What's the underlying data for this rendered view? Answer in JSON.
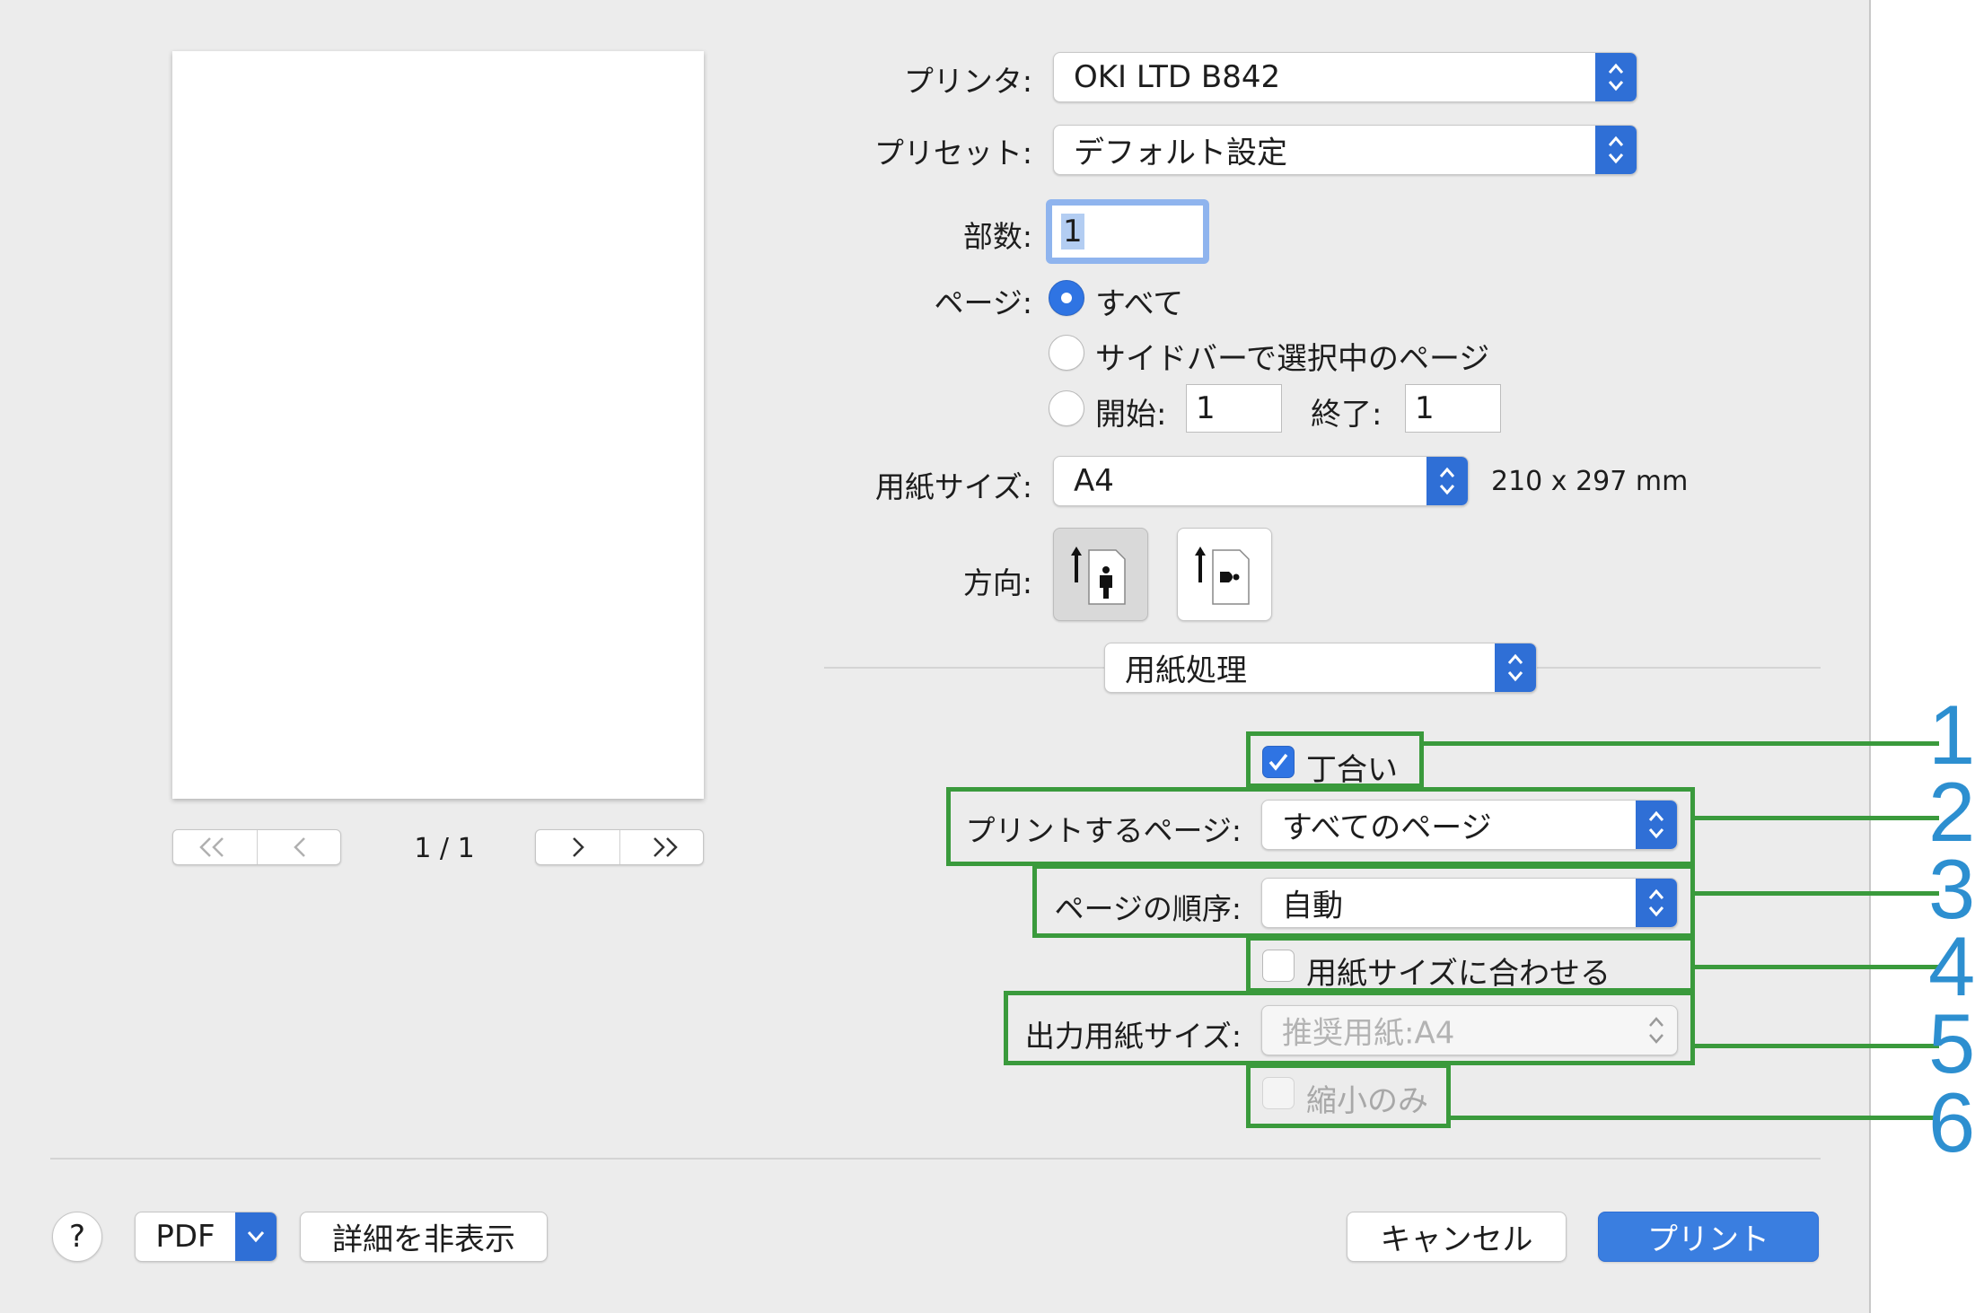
{
  "printer": {
    "label": "プリンタ:",
    "value": "OKI LTD B842"
  },
  "preset": {
    "label": "プリセット:",
    "value": "デフォルト設定"
  },
  "copies": {
    "label": "部数:",
    "value": "1"
  },
  "pages": {
    "label": "ページ:",
    "options": [
      "すべて",
      "サイドバーで選択中のページ"
    ],
    "from_label": "開始:",
    "from_value": "1",
    "to_label": "終了:",
    "to_value": "1",
    "selected": "すべて"
  },
  "paper_size": {
    "label": "用紙サイズ:",
    "value": "A4",
    "dimensions": "210 x 297 mm"
  },
  "orientation": {
    "label": "方向:",
    "selected": "portrait"
  },
  "section": {
    "value": "用紙処理"
  },
  "collate": {
    "label": "丁合い",
    "checked": true
  },
  "pages_to_print": {
    "label": "プリントするページ:",
    "value": "すべてのページ"
  },
  "page_order": {
    "label": "ページの順序:",
    "value": "自動"
  },
  "scale_to_fit": {
    "label": "用紙サイズに合わせる",
    "checked": false
  },
  "output_paper": {
    "label": "出力用紙サイズ:",
    "value": "推奨用紙:A4",
    "enabled": false
  },
  "scale_down_only": {
    "label": "縮小のみ",
    "checked": false,
    "enabled": false
  },
  "preview": {
    "page_indicator": "1 / 1"
  },
  "callouts": [
    "1",
    "2",
    "3",
    "4",
    "5",
    "6"
  ],
  "footer": {
    "help": "?",
    "pdf": "PDF",
    "hide_details": "詳細を非表示",
    "cancel": "キャンセル",
    "print": "プリント"
  },
  "colors": {
    "accent": "#2f6fd6",
    "callout_box": "#3a9a3c",
    "callout_number": "#2d8fd0"
  }
}
